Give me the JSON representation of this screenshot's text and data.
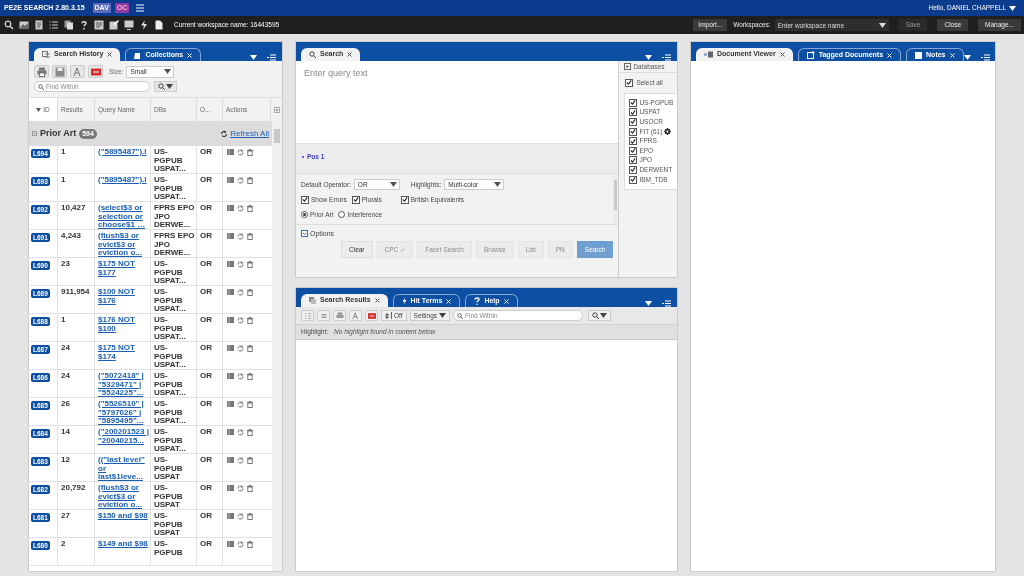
{
  "app": {
    "title": "PE2E SEARCH 2.80.3.15",
    "badges": [
      "DAV",
      "OC"
    ],
    "user": "Hello, DANIEL CHAPPELL"
  },
  "toolbar": {
    "workspace": "Current workspace name: 16443595",
    "import": "Import...",
    "workspaces_label": "Workspaces:",
    "workspace_placeholder": "Enter workspace name",
    "buttons": [
      {
        "label": "Save",
        "disabled": true
      },
      {
        "label": "Close",
        "disabled": false
      },
      {
        "label": "Manage...",
        "disabled": false
      }
    ]
  },
  "history": {
    "tabs": [
      {
        "label": "Search History",
        "selected": true
      },
      {
        "label": "Collections",
        "selected": false
      }
    ],
    "size_label": "Size:",
    "size": "Small",
    "find_placeholder": "Find Within",
    "columns": [
      "ID",
      "Results",
      "Query Name",
      "DBs",
      "O...",
      "Actions"
    ],
    "group": {
      "name": "Prior Art",
      "count": "594",
      "refresh": "Refresh All"
    },
    "rows": [
      {
        "id": "L694",
        "results": "1",
        "query": "(\"5895487\").l",
        "dbs": "US-PGPUB USPAT...",
        "op": "OR"
      },
      {
        "id": "L693",
        "results": "1",
        "query": "(\"5895487\").l",
        "dbs": "US-PGPUB USPAT...",
        "op": "OR"
      },
      {
        "id": "L692",
        "results": "10,427",
        "query": "(select$3 or selection or choose$1 …",
        "dbs": "FPRS EPO JPO DERWE...",
        "op": "OR"
      },
      {
        "id": "L691",
        "results": "4,243",
        "query": "(flush$3 or evict$3 or eviction o...",
        "dbs": "FPRS EPO JPO DERWE...",
        "op": "OR"
      },
      {
        "id": "L690",
        "results": "23",
        "query": "$175 NOT $177",
        "dbs": "US-PGPUB USPAT...",
        "op": "OR"
      },
      {
        "id": "L689",
        "results": "911,954",
        "query": "$100 NOT $176",
        "dbs": "US-PGPUB USPAT...",
        "op": "OR"
      },
      {
        "id": "L688",
        "results": "1",
        "query": "$176 NOT $100",
        "dbs": "US-PGPUB USPAT...",
        "op": "OR"
      },
      {
        "id": "L687",
        "results": "24",
        "query": "$175 NOT $174",
        "dbs": "US-PGPUB USPAT...",
        "op": "OR"
      },
      {
        "id": "L686",
        "results": "24",
        "query": "(\"5072418\" | \"5329471\" | \"5524225\"...",
        "dbs": "US-PGPUB USPAT...",
        "op": "OR"
      },
      {
        "id": "L685",
        "results": "26",
        "query": "(\"5526510\" | \"5797026\" | \"5895495\"...",
        "dbs": "US-PGPUB USPAT...",
        "op": "OR"
      },
      {
        "id": "L684",
        "results": "14",
        "query": "(\"200201523 | \"20040215...",
        "dbs": "US-PGPUB USPAT...",
        "op": "OR"
      },
      {
        "id": "L683",
        "results": "12",
        "query": "((\"last level\" or last$1leve...",
        "dbs": "US-PGPUB USPAT",
        "op": "OR"
      },
      {
        "id": "L682",
        "results": "20,792",
        "query": "(flush$3 or evict$3 or eviction o...",
        "dbs": "US-PGPUB USPAT",
        "op": "OR"
      },
      {
        "id": "L681",
        "results": "27",
        "query": "$150 and $98",
        "dbs": "US-PGPUB USPAT",
        "op": "OR"
      },
      {
        "id": "L680",
        "results": "2",
        "query": "$149 and $98",
        "dbs": "US-PGPUB",
        "op": "OR"
      }
    ]
  },
  "search": {
    "tab": "Search",
    "placeholder": "Enter query text",
    "positions": [
      "Pos 1"
    ],
    "operator_label": "Default Operator:",
    "operator": "OR",
    "highlights_label": "Highlights:",
    "highlights": "Multi-color",
    "checks": [
      {
        "label": "Show Errors",
        "checked": true
      },
      {
        "label": "Plurals",
        "checked": true
      },
      {
        "label": "British Equivalents",
        "checked": true
      }
    ],
    "radios": [
      {
        "label": "Prior Art",
        "selected": true
      },
      {
        "label": "Interference",
        "selected": false
      }
    ],
    "options": "Options",
    "buttons": [
      {
        "label": "Clear",
        "kind": "normal"
      },
      {
        "label": "CPC",
        "kind": "disabled"
      },
      {
        "label": "Facet Search",
        "kind": "disabled"
      },
      {
        "label": "Browse",
        "kind": "disabled"
      },
      {
        "label": "List",
        "kind": "disabled"
      },
      {
        "label": "PN",
        "kind": "disabled"
      },
      {
        "label": "Search",
        "kind": "primary"
      }
    ],
    "databases": {
      "title": "Databases",
      "select_all": {
        "label": "Select all",
        "checked": true
      },
      "items": [
        {
          "label": "US-PGPUB",
          "checked": true,
          "settings": false
        },
        {
          "label": "USPAT",
          "checked": true,
          "settings": false
        },
        {
          "label": "USOCR",
          "checked": true,
          "settings": false
        },
        {
          "label": "FIT (61)",
          "checked": true,
          "settings": true
        },
        {
          "label": "FPRS",
          "checked": true,
          "settings": false
        },
        {
          "label": "EPO",
          "checked": true,
          "settings": false
        },
        {
          "label": "JPO",
          "checked": true,
          "settings": false
        },
        {
          "label": "DERWENT",
          "checked": true,
          "settings": false
        },
        {
          "label": "IBM_TDB",
          "checked": true,
          "settings": false
        }
      ]
    }
  },
  "results": {
    "tabs": [
      {
        "label": "Search Results",
        "selected": true
      },
      {
        "label": "Hit Terms",
        "selected": false
      },
      {
        "label": "Help",
        "selected": false
      }
    ],
    "off": "Off",
    "settings": "Settings",
    "find_placeholder": "Find Within",
    "highlight_label": "Highlight:",
    "highlight_text": "No highlight found in content below"
  },
  "viewer": {
    "tabs": [
      {
        "label": "Document Viewer",
        "selected": true
      },
      {
        "label": "Tagged Documents",
        "selected": false
      },
      {
        "label": "Notes",
        "selected": false
      }
    ]
  }
}
